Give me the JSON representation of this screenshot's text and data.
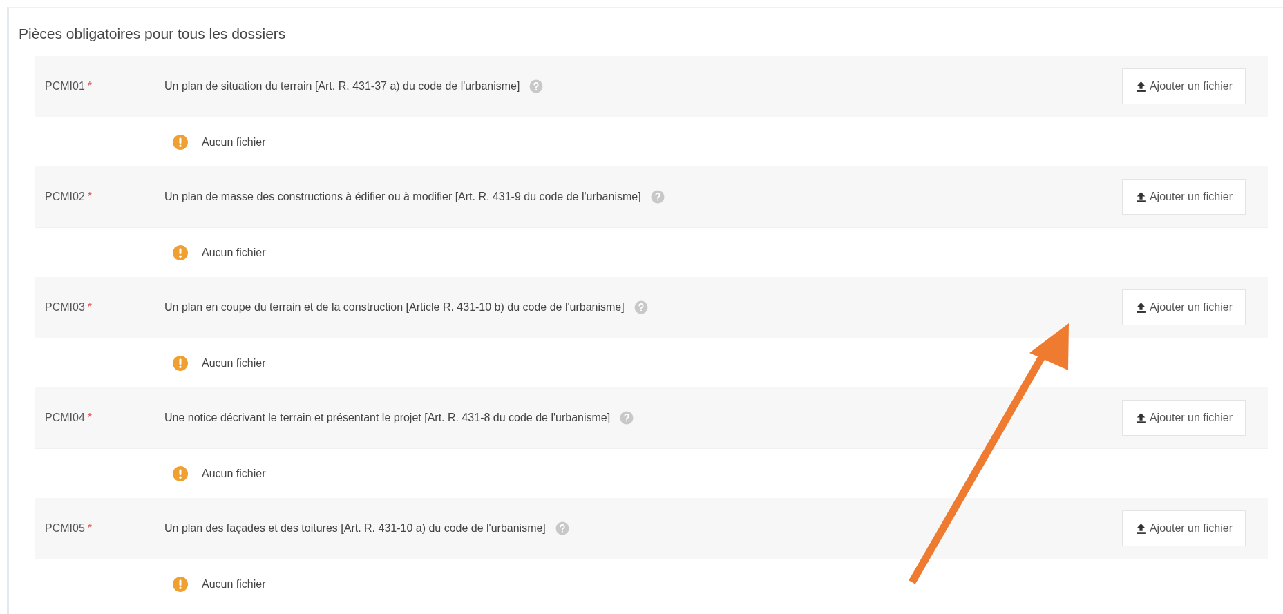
{
  "section": {
    "title": "Pièces obligatoires pour tous les dossiers"
  },
  "documents": [
    {
      "code": "PCMI01",
      "required_mark": "*",
      "description": "Un plan de situation du terrain [Art. R. 431-37 a) du code de l'urbanisme]",
      "button": "Ajouter un fichier",
      "status": "Aucun fichier"
    },
    {
      "code": "PCMI02",
      "required_mark": "*",
      "description": "Un plan de masse des constructions à édifier ou à modifier [Art. R. 431-9 du code de l'urbanisme]",
      "button": "Ajouter un fichier",
      "status": "Aucun fichier"
    },
    {
      "code": "PCMI03",
      "required_mark": "*",
      "description": "Un plan en coupe du terrain et de la construction [Article R. 431-10 b) du code de l'urbanisme]",
      "button": "Ajouter un fichier",
      "status": "Aucun fichier"
    },
    {
      "code": "PCMI04",
      "required_mark": "*",
      "description": "Une notice décrivant le terrain et présentant le projet [Art. R. 431-8 du code de l'urbanisme]",
      "button": "Ajouter un fichier",
      "status": "Aucun fichier"
    },
    {
      "code": "PCMI05",
      "required_mark": "*",
      "description": "Un plan des façades et des toitures [Art. R. 431-10 a) du code de l'urbanisme]",
      "button": "Ajouter un fichier",
      "status": "Aucun fichier"
    }
  ]
}
